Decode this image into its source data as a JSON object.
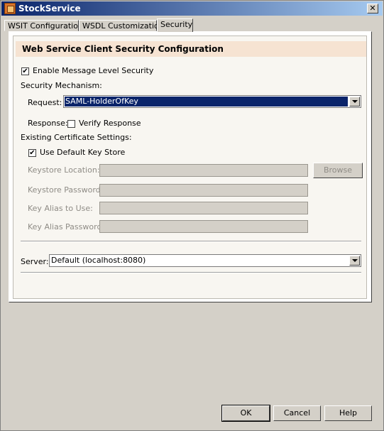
{
  "window": {
    "title": "StockService",
    "close_label": "✕"
  },
  "tabs": [
    {
      "label": "WSIT Configuration"
    },
    {
      "label": "WSDL Customization"
    },
    {
      "label": "Security"
    }
  ],
  "panel": {
    "heading": "Web Service Client Security Configuration",
    "enable_msg_security": {
      "label": "Enable Message Level Security",
      "checked": true
    },
    "security_mechanism_label": "Security Mechanism:",
    "request": {
      "label": "Request:",
      "value": "SAML-HolderOfKey"
    },
    "response": {
      "label": "Response:",
      "verify_label": "Verify Response",
      "checked": false
    },
    "cert_settings_label": "Existing Certificate Settings:",
    "use_default_keystore": {
      "label": "Use Default Key Store",
      "checked": true
    },
    "keystore_location": {
      "label": "Keystore Location:",
      "value": ""
    },
    "browse_label": "Browse",
    "keystore_password": {
      "label": "Keystore Password:",
      "value": ""
    },
    "key_alias": {
      "label": "Key Alias to Use:",
      "value": ""
    },
    "key_alias_password": {
      "label": "Key Alias Password:",
      "value": ""
    },
    "server": {
      "label": "Server:",
      "value": "Default (localhost:8080)"
    }
  },
  "footer": {
    "ok": "OK",
    "cancel": "Cancel",
    "help": "Help"
  },
  "icons": {
    "checked": "✔"
  }
}
